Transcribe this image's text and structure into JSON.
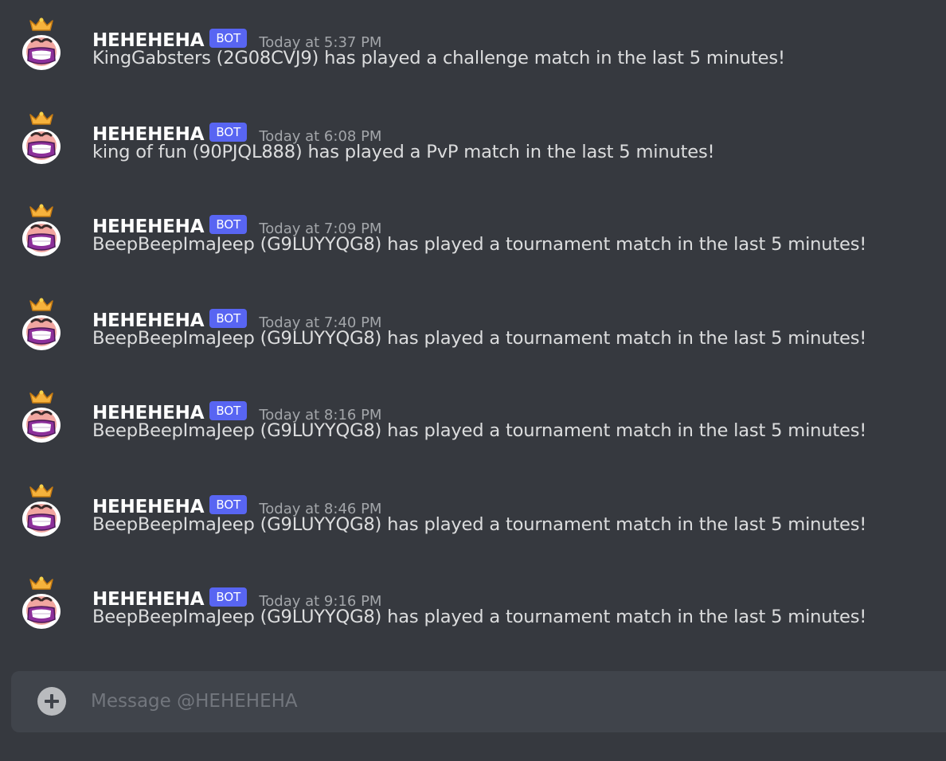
{
  "messages": [
    {
      "author": "HEHEHEHA",
      "tag": "BOT",
      "time": "Today at 5:37 PM",
      "text": "KingGabsters (2G08CVJ9) has played a challenge match in the last 5 minutes!"
    },
    {
      "author": "HEHEHEHA",
      "tag": "BOT",
      "time": "Today at 6:08 PM",
      "text": "king of fun (90PJQL888) has played a PvP match in the last 5 minutes!"
    },
    {
      "author": "HEHEHEHA",
      "tag": "BOT",
      "time": "Today at 7:09 PM",
      "text": "BeepBeepImaJeep (G9LUYYQG8) has played a tournament match in the last 5 minutes!"
    },
    {
      "author": "HEHEHEHA",
      "tag": "BOT",
      "time": "Today at 7:40 PM",
      "text": "BeepBeepImaJeep (G9LUYYQG8) has played a tournament match in the last 5 minutes!"
    },
    {
      "author": "HEHEHEHA",
      "tag": "BOT",
      "time": "Today at 8:16 PM",
      "text": "BeepBeepImaJeep (G9LUYYQG8) has played a tournament match in the last 5 minutes!"
    },
    {
      "author": "HEHEHEHA",
      "tag": "BOT",
      "time": "Today at 8:46 PM",
      "text": "BeepBeepImaJeep (G9LUYYQG8) has played a tournament match in the last 5 minutes!"
    },
    {
      "author": "HEHEHEHA",
      "tag": "BOT",
      "time": "Today at 9:16 PM",
      "text": "BeepBeepImaJeep (G9LUYYQG8) has played a tournament match in the last 5 minutes!"
    }
  ],
  "avatar_icon": "laughing-king-emote-icon",
  "composer": {
    "placeholder": "Message @HEHEHEHA",
    "value": "",
    "attach_icon": "plus-circle-icon"
  },
  "colors": {
    "background": "#36393f",
    "composer": "#40444b",
    "bot_tag": "#5865f2",
    "username": "#ffffff",
    "text": "#dcddde",
    "timestamp": "#a3a6aa"
  }
}
